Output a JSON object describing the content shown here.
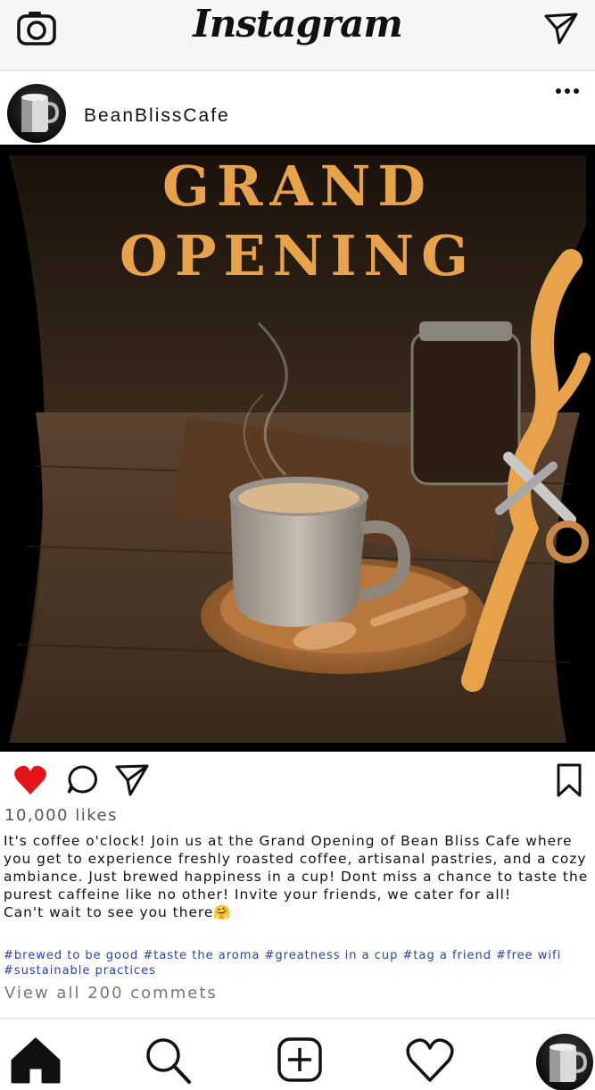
{
  "app": {
    "title": "Instagram"
  },
  "post": {
    "username": "BeanBlissCafe",
    "image": {
      "headline_line1": "GRAND",
      "headline_line2": "OPENING"
    },
    "likes": "10,000 likes",
    "caption": "It's coffee o'clock! Join us at the Grand Opening of Bean Bliss Cafe where you get to experience freshly roasted coffee, artisanal pastries, and a cozy ambiance. Just brewed happiness in a cup! Dont miss a chance to taste the purest caffeine like no other! Invite your friends, we cater for all!",
    "caption_closing": "Can't wait to see you there",
    "caption_emoji": "🤗",
    "hashtags": "#brewed to be good #taste the aroma #greatness in a cup #tag a friend #free wifi #sustainable practices",
    "view_comments": "View all 200 commets",
    "liked": true
  },
  "icons": {
    "top": [
      "camera-icon",
      "direct-message-icon"
    ],
    "post": [
      "more-options-icon",
      "heart-icon",
      "comment-icon",
      "share-icon",
      "bookmark-icon"
    ],
    "nav": [
      "home-icon",
      "search-icon",
      "add-post-icon",
      "activity-heart-icon",
      "profile-avatar"
    ]
  },
  "colors": {
    "headline": "#e8a24a",
    "like_red": "#e4141b",
    "hashtag_blue": "#2a3fb4",
    "ribbon": "#e8a24a"
  }
}
